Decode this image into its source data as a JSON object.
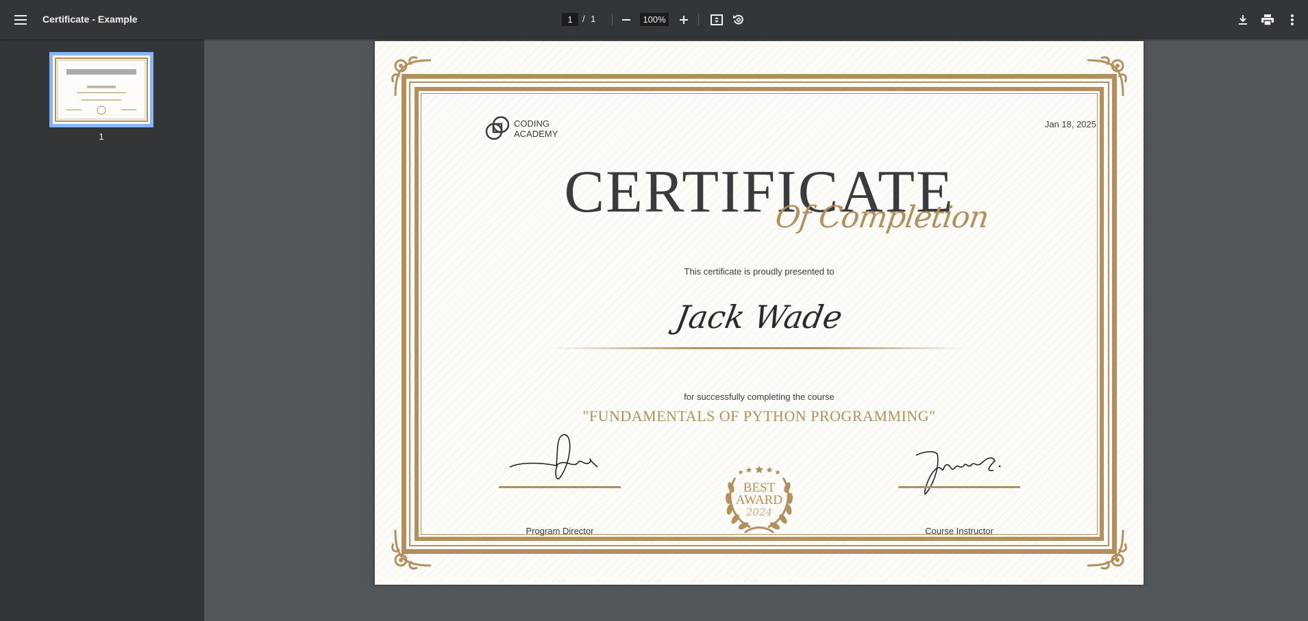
{
  "toolbar": {
    "title": "Certificate - Example",
    "page_current": "1",
    "page_separator": "/",
    "page_total": "1",
    "zoom": "100%"
  },
  "sidebar": {
    "thumbnails": [
      {
        "label": "1",
        "selected": true
      }
    ]
  },
  "certificate": {
    "logo_line1": "CODING",
    "logo_line2": "ACADEMY",
    "date": "Jan 18, 2025",
    "title": "CERTIFICATE",
    "subtitle": "Of Completion",
    "presented_text": "This certificate is proudly presented to",
    "recipient": "Jack Wade",
    "completing_text": "for successfully completing the course",
    "course": "\"FUNDAMENTALS OF PYTHON PROGRAMMING\"",
    "award_line1": "BEST",
    "award_line2": "AWARD",
    "award_year": "2024",
    "signer1_label": "Program Director",
    "signer2_label": "Course Instructor",
    "accent_color": "#b28f5d"
  }
}
